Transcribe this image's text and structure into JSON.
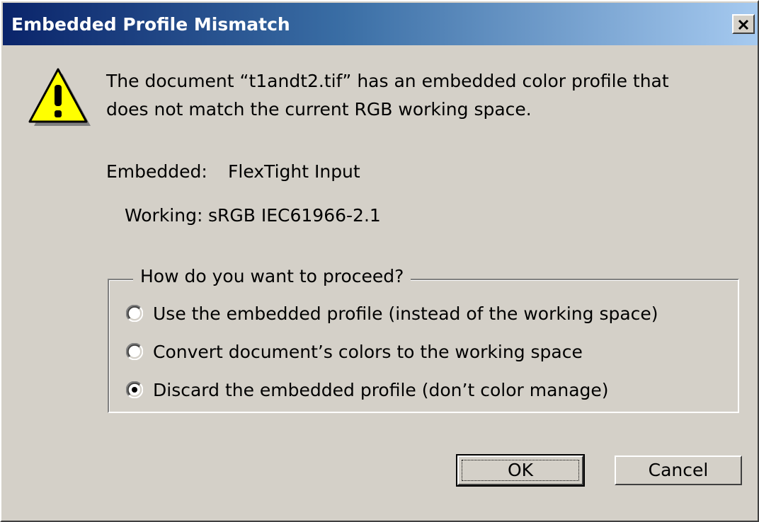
{
  "window": {
    "title": "Embedded Profile Mismatch",
    "close_icon": "close-icon"
  },
  "message": {
    "icon": "warning-icon",
    "line1": "The document “t1andt2.tif” has an embedded color profile that",
    "line2": "does not match the current RGB working space."
  },
  "profiles": {
    "embedded_label": "Embedded:",
    "embedded_value": "FlexTight Input",
    "working_label": "Working:",
    "working_value": "sRGB IEC61966-2.1"
  },
  "options": {
    "legend": "How do you want to proceed?",
    "items": [
      {
        "label": "Use the embedded profile (instead of the working space)",
        "selected": false
      },
      {
        "label": "Convert document’s colors to the working space",
        "selected": false
      },
      {
        "label": "Discard the embedded profile (don’t color manage)",
        "selected": true
      }
    ]
  },
  "buttons": {
    "ok": "OK",
    "cancel": "Cancel"
  },
  "colors": {
    "title_start": "#0a246a",
    "title_end": "#a6caf0",
    "face": "#d4d0c8",
    "warning_yellow": "#ffff00"
  }
}
